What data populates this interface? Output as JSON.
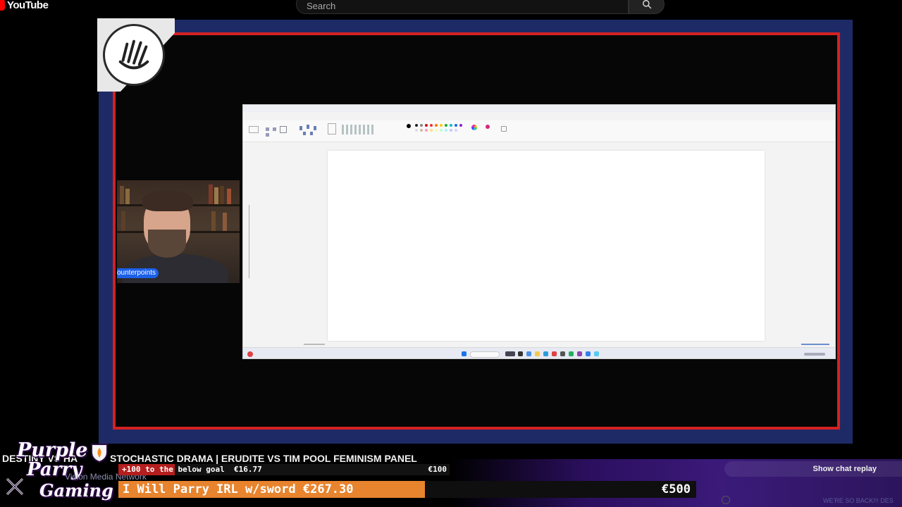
{
  "youtube": {
    "logo_text": "YouTube",
    "search_placeholder": "Search",
    "search_icon": "search-icon"
  },
  "colors": {
    "frame_blue": "#1e2a66",
    "frame_red": "#d42121",
    "name_tag_blue": "#1c60e8",
    "goal_orange": "#e8842e",
    "goal_red": "#b51e1e",
    "banner_purple": "#3b1a7a"
  },
  "stream": {
    "webcam_name": "ounterpoints",
    "title_prefix": "DESTINY VS HA",
    "title": "STOCHASTIC DRAMA | ERUDITE VS TIM POOL FEMINISM PANEL",
    "branding": {
      "line1": "Purple",
      "line2": "Parry",
      "line3": "Gaming"
    },
    "network_ghost": "Vision Media Network",
    "goal_small": {
      "text": "+100 to the below goal",
      "current": "€16.77",
      "target": "€100",
      "progress_percent": 17
    },
    "goal_big": {
      "text": "I Will Parry IRL w/sword €267.30",
      "target": "€500",
      "progress_percent": 53
    },
    "ticker_ghost": "WE'RE SO BACK!!! DES"
  },
  "chat": {
    "show_replay_label": "Show chat replay"
  }
}
